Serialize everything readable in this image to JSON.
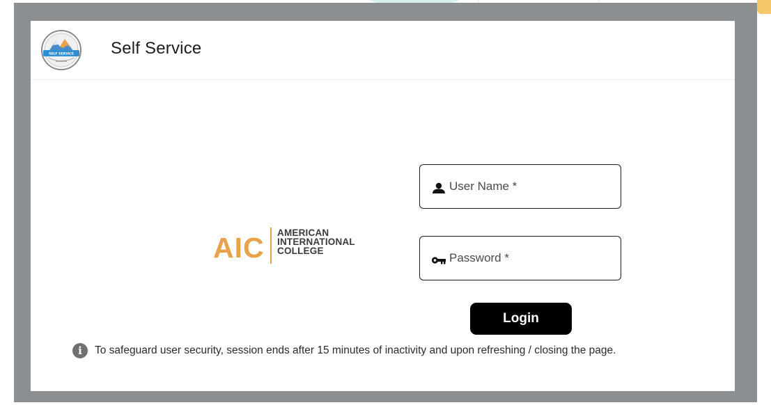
{
  "header": {
    "logo_text_top": "SELF SERVICE",
    "logo_text_bottom": "ELLUCIAN",
    "title": "Self Service"
  },
  "institution": {
    "abbreviation": "AIC",
    "name_lines": [
      "AMERICAN",
      "INTERNATIONAL",
      "COLLEGE"
    ],
    "brand_color": "#e8a24a"
  },
  "login_form": {
    "username": {
      "placeholder": "User Name *",
      "value": "",
      "icon": "person-icon"
    },
    "password": {
      "placeholder": "Password *",
      "value": "",
      "icon": "key-icon"
    },
    "submit_label": "Login"
  },
  "notice": {
    "icon": "info-icon",
    "icon_glyph": "i",
    "text": "To safeguard user security, session ends after 15 minutes of inactivity and upon refreshing / closing the page."
  },
  "colors": {
    "frame": "#8c8f92",
    "button": "#000000",
    "accent_orange": "#e8a24a"
  }
}
